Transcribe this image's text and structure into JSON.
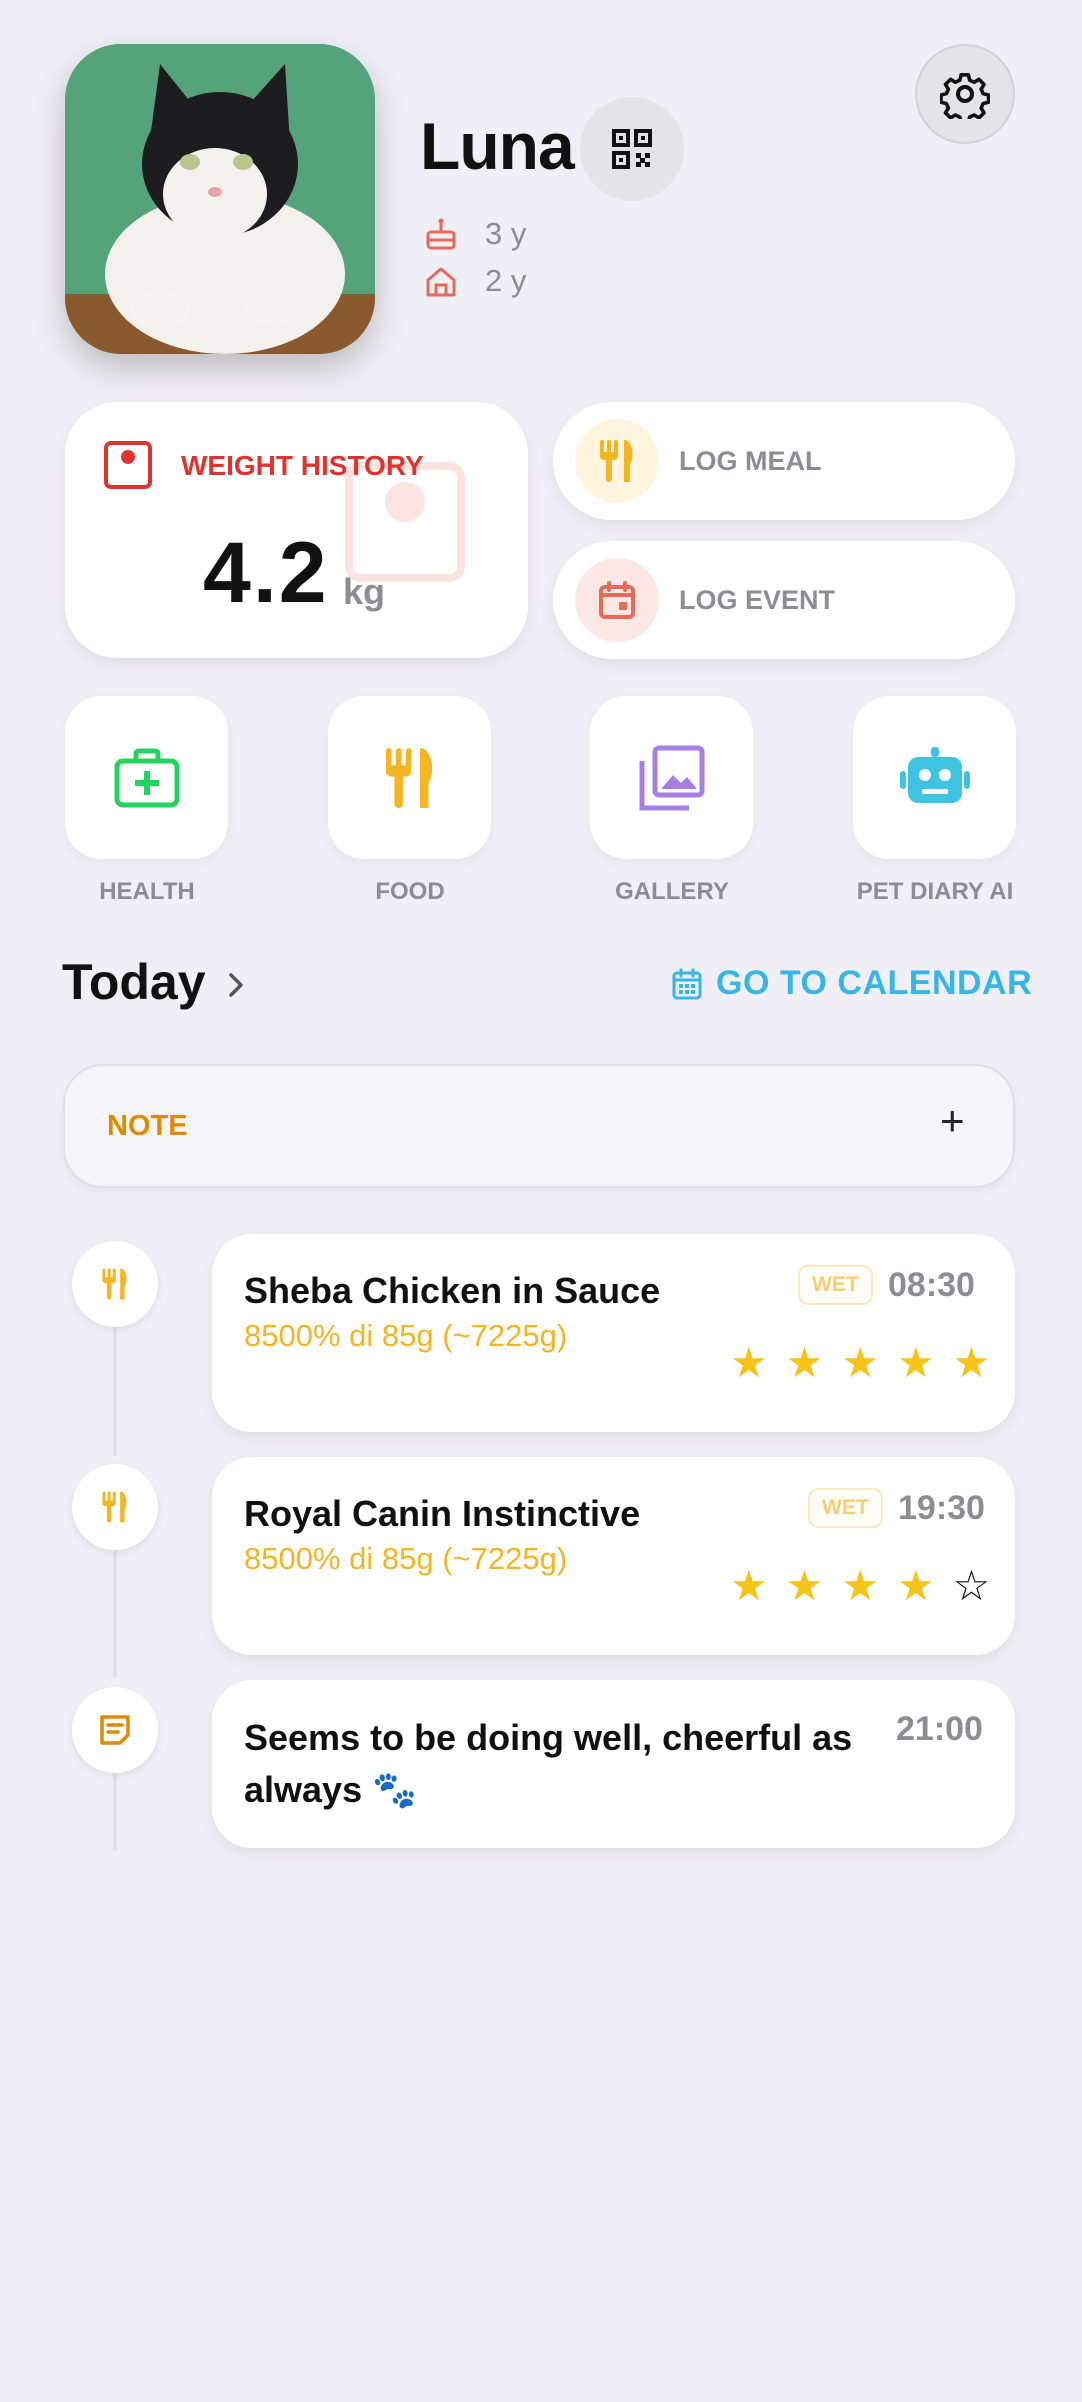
{
  "pet": {
    "name": "Luna",
    "age": "3 y",
    "time_with_owner": "2 y"
  },
  "weight": {
    "title": "WEIGHT HISTORY",
    "value": "4.2",
    "unit": "kg"
  },
  "actions": {
    "log_meal": "LOG MEAL",
    "log_event": "LOG EVENT"
  },
  "tiles": [
    {
      "label": "HEALTH",
      "icon": "medical-kit-icon",
      "color": "#22d35e"
    },
    {
      "label": "FOOD",
      "icon": "fork-knife-icon",
      "color": "#f6b521"
    },
    {
      "label": "GALLERY",
      "icon": "gallery-icon",
      "color": "#a77ee8"
    },
    {
      "label": "PET DIARY AI",
      "icon": "robot-icon",
      "color": "#3fc3e2"
    }
  ],
  "today": {
    "title": "Today",
    "calendar_link": "GO TO CALENDAR"
  },
  "note": {
    "label": "NOTE",
    "add": "+"
  },
  "entries": [
    {
      "type": "meal",
      "title": "Sheba Chicken in Sauce",
      "subtitle": "8500% di 85g (~7225g)",
      "badge": "WET",
      "time": "08:30",
      "rating": 5,
      "rating_max": 5
    },
    {
      "type": "meal",
      "title": "Royal Canin Instinctive",
      "subtitle": "8500% di 85g (~7225g)",
      "badge": "WET",
      "time": "19:30",
      "rating": 4,
      "rating_max": 5
    },
    {
      "type": "note",
      "title": "Seems to be doing well, cheerful as always 🐾",
      "time": "21:00"
    }
  ],
  "colors": {
    "weight_red": "#e0332f",
    "meal_yellow": "#f3b521",
    "note_orange": "#e08a00",
    "calendar_blue": "#36b6e8",
    "star_yellow": "#f6c419"
  }
}
